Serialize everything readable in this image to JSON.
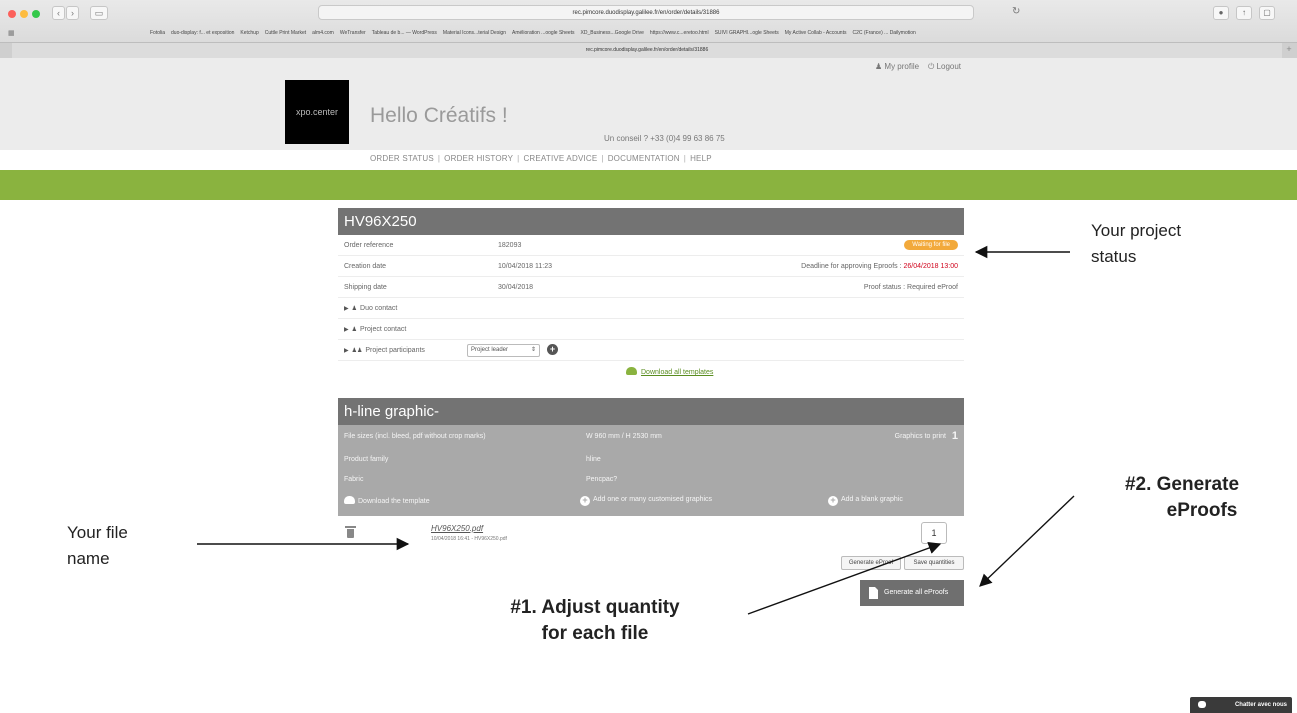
{
  "browser": {
    "url": "rec.pimcore.duodisplay.galilee.fr/en/order/details/31886",
    "tab_title": "rec.pimcore.duodisplay.galilee.fr/en/order/details/31886",
    "back": "‹",
    "forward": "›",
    "sidebar": "▭",
    "reload": "↻",
    "bookmarks": [
      "Fotolia",
      "duo-display: f... et exposition",
      "Ketchup",
      "Cuttle Print Market",
      "alm4.com",
      "WeTransfer",
      "Tableau de b... — WordPress",
      "Material Icons...terial Design",
      "Amélioration ...oogle Sheets",
      "XD_Business...Google Drive",
      "https://www.c...eretoo.html",
      "SUIVI GRAPHI...ogle Sheets",
      "My Active Collab - Accounts",
      "C2C (France) ... Dailymotion"
    ]
  },
  "header": {
    "logo_text": "xpo.center",
    "greeting": "Hello Créatifs !",
    "advice": "Un conseil ? +33 (0)4 99 63 86 75",
    "my_profile": "My profile",
    "logout": "Logout",
    "nav": [
      "ORDER STATUS",
      "ORDER HISTORY",
      "CREATIVE ADVICE",
      "DOCUMENTATION",
      "HELP"
    ]
  },
  "order": {
    "title": "HV96X250",
    "rows": {
      "reference_label": "Order reference",
      "reference_value": "182093",
      "status": "Waiting for file",
      "creation_label": "Creation date",
      "creation_value": "10/04/2018 11:23",
      "deadline_label": "Deadline for approving Eproofs :",
      "deadline_value": "26/04/2018 13:00",
      "shipping_label": "Shipping date",
      "shipping_value": "30/04/2018",
      "proof_status": "Proof status : Required eProof",
      "duo_contact": "Duo contact",
      "project_contact": "Project contact",
      "participants_label": "Project participants",
      "participants_select": "Project leader",
      "download_all": "Download all templates"
    }
  },
  "graphic": {
    "title": "h-line graphic-",
    "file_sizes_label": "File sizes (incl. bleed, pdf without crop marks)",
    "file_sizes_value": "W 960 mm / H 2530 mm",
    "graphics_to_print_label": "Graphics to print",
    "graphics_to_print_value": "1",
    "product_family_label": "Product family",
    "product_family_value": "hline",
    "fabric_label": "Fabric",
    "fabric_value": "Pencpac?",
    "download_template": "Download the template",
    "add_customised": "Add one or many customised graphics",
    "add_blank": "Add a blank graphic",
    "file_name": "HV96X250.pdf",
    "file_meta": "10/04/2018 16:41 - HV96X250.pdf",
    "quantity": "1",
    "generate_eproof": "Generate eProof",
    "save_quantities": "Save quantities",
    "generate_all": "Generate all eProofs"
  },
  "annotations": {
    "status_l1": "Your project",
    "status_l2": "status",
    "file_l1": "Your file",
    "file_l2": "name",
    "step2_l1": "#2. Generate",
    "step2_l2": "eProofs",
    "step1_l1": "#1. Adjust quantity",
    "step1_l2": "for each file"
  },
  "chat": "Chatter avec nous"
}
